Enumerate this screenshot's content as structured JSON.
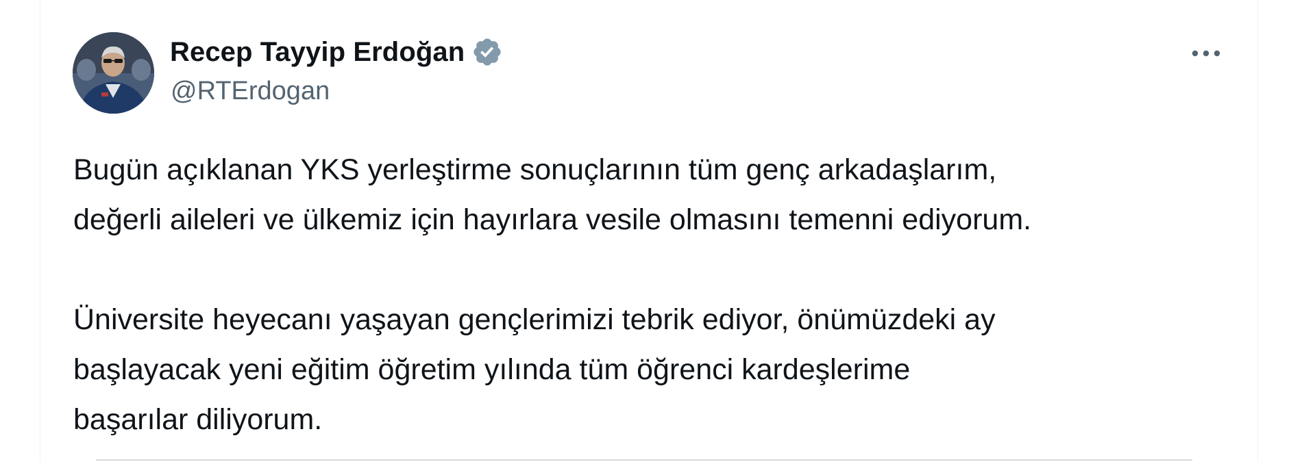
{
  "author": {
    "display_name": "Recep Tayyip Erdoğan",
    "handle": "@RTErdogan",
    "verified_color": "#829aab"
  },
  "tweet": {
    "paragraphs": [
      "Bugün açıklanan YKS yerleştirme sonuçlarının tüm genç arkadaşlarım,\ndeğerli aileleri ve ülkemiz için hayırlara vesile olmasını temenni ediyorum.",
      "Üniversite heyecanı yaşayan gençlerimizi tebrik ediyor, önümüzdeki ay\nbaşlayacak yeni eğitim öğretim yılında tüm öğrenci kardeşlerime\nbaşarılar diliyorum."
    ]
  },
  "icons": {
    "verified": "verified-badge-icon",
    "more": "more-horizontal-icon",
    "avatar": "profile-photo"
  },
  "colors": {
    "text": "#0f1419",
    "secondary_text": "#536471",
    "badge": "#829aab"
  }
}
